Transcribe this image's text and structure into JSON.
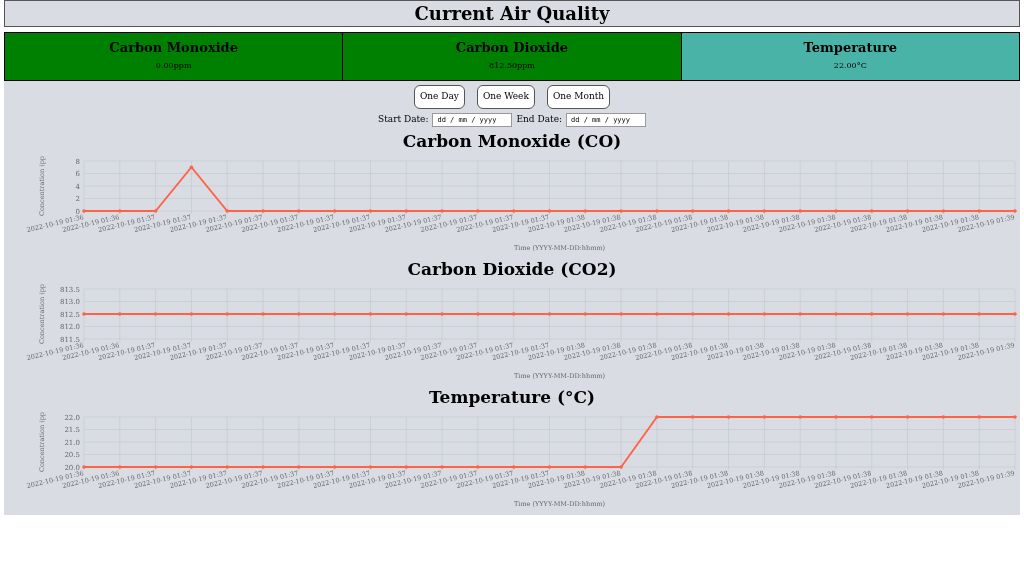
{
  "title": "Current Air Quality",
  "readings": [
    {
      "name": "Carbon Monoxide",
      "value": "0.00ppm",
      "color": "#008000"
    },
    {
      "name": "Carbon Dioxide",
      "value": "812.50ppm",
      "color": "#008000"
    },
    {
      "name": "Temperature",
      "value": "22.00°C",
      "color": "#4ab3a8"
    }
  ],
  "range_buttons": [
    {
      "label": "One Day"
    },
    {
      "label": "One Week"
    },
    {
      "label": "One Month"
    }
  ],
  "date_fields": [
    {
      "label": "Start Date:",
      "placeholder": "dd / mm / yyyy"
    },
    {
      "label": "End Date:",
      "placeholder": "dd / mm / yyyy"
    }
  ],
  "charts": [
    {
      "title": "Carbon Monoxide (CO)",
      "chart_data": {
        "type": "line",
        "grid": true,
        "xlabel": "Time (YYYY-MM-DD:hhmm)",
        "ylabel": "Concentration (pp",
        "ylim": [
          0,
          8
        ],
        "yticks": [
          0,
          2,
          4,
          6,
          8
        ],
        "categories": [
          "2022-10-19 01:36",
          "2022-10-19 01:36",
          "2022-10-19 01:37",
          "2022-10-19 01:37",
          "2022-10-19 01:37",
          "2022-10-19 01:37",
          "2022-10-19 01:37",
          "2022-10-19 01:37",
          "2022-10-19 01:37",
          "2022-10-19 01:37",
          "2022-10-19 01:37",
          "2022-10-19 01:37",
          "2022-10-19 01:37",
          "2022-10-19 01:37",
          "2022-10-19 01:38",
          "2022-10-19 01:38",
          "2022-10-19 01:38",
          "2022-10-19 01:38",
          "2022-10-19 01:38",
          "2022-10-19 01:38",
          "2022-10-19 01:38",
          "2022-10-19 01:38",
          "2022-10-19 01:38",
          "2022-10-19 01:38",
          "2022-10-19 01:38",
          "2022-10-19 01:38",
          "2022-10-19 01:39"
        ],
        "series": [
          {
            "color": "#ff6347",
            "values": [
              0,
              0,
              0,
              7,
              0,
              0,
              0,
              0,
              0,
              0,
              0,
              0,
              0,
              0,
              0,
              0,
              0,
              0,
              0,
              0,
              0,
              0,
              0,
              0,
              0,
              0,
              0
            ]
          }
        ]
      }
    },
    {
      "title": "Carbon Dioxide (CO2)",
      "chart_data": {
        "type": "line",
        "grid": true,
        "xlabel": "Time (YYYY-MM-DD:hhmm)",
        "ylabel": "Concentration (pp",
        "ylim": [
          811.5,
          813.5
        ],
        "yticks": [
          {
            "value": 811.5,
            "label": "811.5"
          },
          {
            "value": 812,
            "label": "812.0"
          },
          {
            "value": 812.5,
            "label": "812.5"
          },
          {
            "value": 813,
            "label": "813.0"
          },
          {
            "value": 813.5,
            "label": "813.5"
          }
        ],
        "categories": [
          "2022-10-19 01:36",
          "2022-10-19 01:36",
          "2022-10-19 01:37",
          "2022-10-19 01:37",
          "2022-10-19 01:37",
          "2022-10-19 01:37",
          "2022-10-19 01:37",
          "2022-10-19 01:37",
          "2022-10-19 01:37",
          "2022-10-19 01:37",
          "2022-10-19 01:37",
          "2022-10-19 01:37",
          "2022-10-19 01:37",
          "2022-10-19 01:37",
          "2022-10-19 01:38",
          "2022-10-19 01:38",
          "2022-10-19 01:38",
          "2022-10-19 01:38",
          "2022-10-19 01:38",
          "2022-10-19 01:38",
          "2022-10-19 01:38",
          "2022-10-19 01:38",
          "2022-10-19 01:38",
          "2022-10-19 01:38",
          "2022-10-19 01:38",
          "2022-10-19 01:38",
          "2022-10-19 01:39"
        ],
        "series": [
          {
            "color": "#ff6347",
            "values": [
              812.5,
              812.5,
              812.5,
              812.5,
              812.5,
              812.5,
              812.5,
              812.5,
              812.5,
              812.5,
              812.5,
              812.5,
              812.5,
              812.5,
              812.5,
              812.5,
              812.5,
              812.5,
              812.5,
              812.5,
              812.5,
              812.5,
              812.5,
              812.5,
              812.5,
              812.5,
              812.5
            ]
          }
        ]
      }
    },
    {
      "title": "Temperature (°C)",
      "chart_data": {
        "type": "line",
        "grid": true,
        "xlabel": "Time (YYYY-MM-DD:hhmm)",
        "ylabel": "Concentration (pp",
        "ylim": [
          20,
          22
        ],
        "yticks": [
          {
            "value": 20,
            "label": "20.0"
          },
          {
            "value": 20.5,
            "label": "20.5"
          },
          {
            "value": 21,
            "label": "21.0"
          },
          {
            "value": 21.5,
            "label": "21.5"
          },
          {
            "value": 22,
            "label": "22.0"
          }
        ],
        "categories": [
          "2022-10-19 01:36",
          "2022-10-19 01:36",
          "2022-10-19 01:37",
          "2022-10-19 01:37",
          "2022-10-19 01:37",
          "2022-10-19 01:37",
          "2022-10-19 01:37",
          "2022-10-19 01:37",
          "2022-10-19 01:37",
          "2022-10-19 01:37",
          "2022-10-19 01:37",
          "2022-10-19 01:37",
          "2022-10-19 01:37",
          "2022-10-19 01:37",
          "2022-10-19 01:38",
          "2022-10-19 01:38",
          "2022-10-19 01:38",
          "2022-10-19 01:38",
          "2022-10-19 01:38",
          "2022-10-19 01:38",
          "2022-10-19 01:38",
          "2022-10-19 01:38",
          "2022-10-19 01:38",
          "2022-10-19 01:38",
          "2022-10-19 01:38",
          "2022-10-19 01:38",
          "2022-10-19 01:39"
        ],
        "series": [
          {
            "color": "#ff6347",
            "values": [
              20,
              20,
              20,
              20,
              20,
              20,
              20,
              20,
              20,
              20,
              20,
              20,
              20,
              20,
              20,
              20,
              22,
              22,
              22,
              22,
              22,
              22,
              22,
              22,
              22,
              22,
              22
            ]
          }
        ]
      }
    }
  ]
}
